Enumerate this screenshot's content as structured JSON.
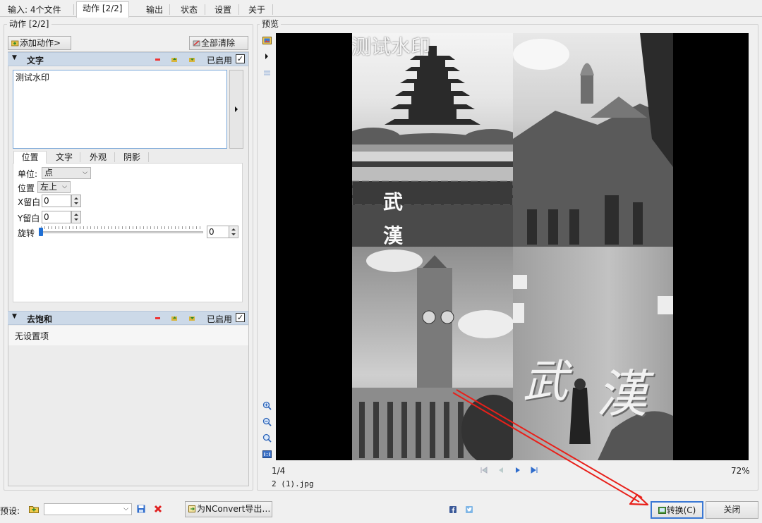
{
  "tabs": [
    "输入: 4个文件",
    "动作 [2/2]",
    "输出",
    "状态",
    "设置",
    "关于"
  ],
  "actions_panel": {
    "group_title": "动作 [2/2]",
    "add_action_label": "添加动作>",
    "clear_all_label": "全部清除"
  },
  "text_action": {
    "title": "文字",
    "enabled_label": "已启用",
    "enabled": true,
    "text_value": "测试水印",
    "sub_tabs": [
      "位置",
      "文字",
      "外观",
      "阴影"
    ],
    "unit_label": "单位:",
    "unit_value": "点",
    "position_label": "位置",
    "position_value": "左上",
    "x_margin_label": "X留白",
    "x_margin_value": "0",
    "y_margin_label": "Y留白",
    "y_margin_value": "0",
    "rotate_label": "旋转",
    "rotate_value": "0"
  },
  "desaturate_action": {
    "title": "去饱和",
    "enabled_label": "已启用",
    "enabled": true,
    "no_settings": "无设置项"
  },
  "preview": {
    "group_title": "预览",
    "watermark": "测试水印",
    "sign_chars": [
      "武",
      "漢"
    ],
    "wall_chars": [
      "武",
      "漢"
    ],
    "page_counter": "1/4",
    "zoom": "72%",
    "filename": "2 (1).jpg"
  },
  "bottom": {
    "preset_label": "预设:",
    "preset_value": "",
    "export_label": "为NConvert导出…",
    "convert_label": "转换(C)",
    "close_label": "关闭"
  },
  "colors": {
    "action_header_bg": "#ccd9e8",
    "annotation_red": "#e8201a",
    "preview_bg": "#000000"
  }
}
